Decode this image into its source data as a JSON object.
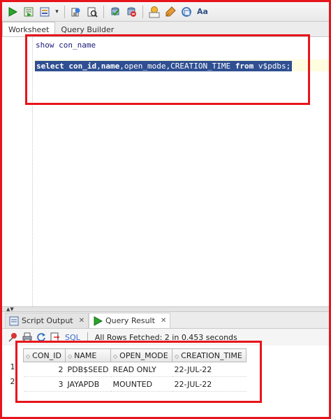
{
  "toolbar": {
    "buttons": [
      "run-statement-icon",
      "run-script-icon",
      "autotrace-icon",
      "dropdown-arrow-icon",
      "explain-plan-icon",
      "sql-tuning-icon",
      "commit-icon",
      "rollback-icon",
      "sql-history-icon",
      "clear-icon",
      "format-icon",
      "to-upper-icon"
    ],
    "dropdown_glyph": "▾",
    "sql_badge": "SQL",
    "case_label": "Aa"
  },
  "editor_tabs": [
    "Worksheet",
    "Query Builder"
  ],
  "editor": {
    "line1": "show con_name",
    "line2": {
      "kw_select": "select",
      "cols_a": " con_id",
      "comma1": ",",
      "cols_b": "name",
      "rest_a": ",open_mode,CREATION_TIME ",
      "kw_from": "from",
      "rest_b": " v$pdbs;"
    }
  },
  "result_tabs": [
    {
      "label": "Script Output",
      "active": false
    },
    {
      "label": "Query Result",
      "active": true
    }
  ],
  "result_toolbar": {
    "sql_label": "SQL",
    "status": "All Rows Fetched: 2 in 0.453 seconds"
  },
  "grid": {
    "columns": [
      "CON_ID",
      "NAME",
      "OPEN_MODE",
      "CREATION_TIME"
    ],
    "rows": [
      {
        "num": "1",
        "con_id": "2",
        "name": "PDB$SEED",
        "open_mode": "READ ONLY",
        "creation_time": "22-JUL-22"
      },
      {
        "num": "2",
        "con_id": "3",
        "name": "JAYAPDB",
        "open_mode": "MOUNTED",
        "creation_time": "22-JUL-22"
      }
    ]
  },
  "colors": {
    "annotation_red": "#e8141b",
    "selection_blue": "#2f4f92",
    "keyword_navy": "#1a1a7a"
  }
}
